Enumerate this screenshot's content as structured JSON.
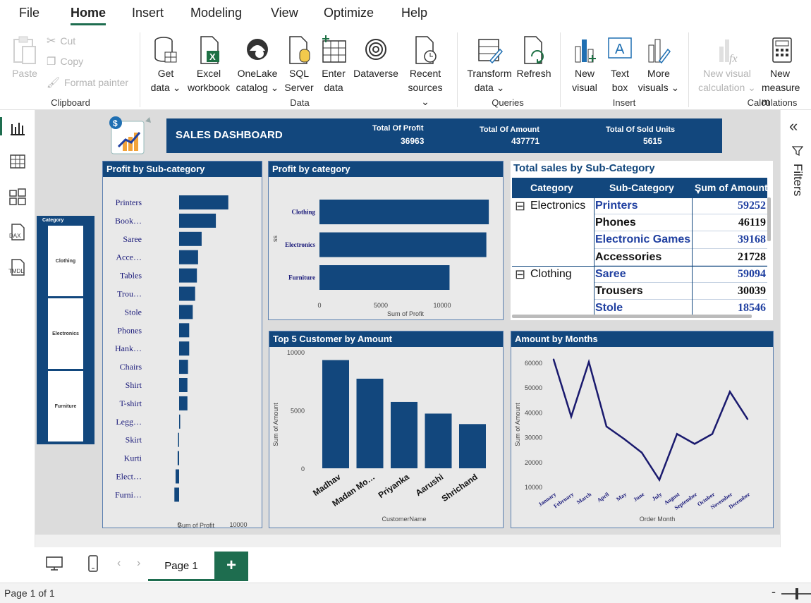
{
  "menu": [
    "File",
    "Home",
    "Insert",
    "Modeling",
    "View",
    "Optimize",
    "Help"
  ],
  "ribbon": {
    "clipboard": {
      "paste": "Paste",
      "cut": "Cut",
      "copy": "Copy",
      "format_painter": "Format painter",
      "group": "Clipboard"
    },
    "data": {
      "get_data": [
        "Get",
        "data ⌄"
      ],
      "excel": [
        "Excel",
        "workbook"
      ],
      "onelake": [
        "OneLake",
        "catalog ⌄"
      ],
      "sql": [
        "SQL",
        "Server"
      ],
      "enter": [
        "Enter",
        "data"
      ],
      "dataverse": [
        "Dataverse"
      ],
      "recent": [
        "Recent",
        "sources ⌄"
      ],
      "group": "Data"
    },
    "queries": {
      "transform": [
        "Transform",
        "data ⌄"
      ],
      "refresh": [
        "Refresh"
      ],
      "group": "Queries"
    },
    "insert": {
      "new_visual": [
        "New",
        "visual"
      ],
      "text_box": [
        "Text",
        "box"
      ],
      "more_visuals": [
        "More",
        "visuals ⌄"
      ],
      "group": "Insert"
    },
    "calculations": {
      "new_visual_calc": [
        "New visual",
        "calculation ⌄"
      ],
      "new_measure": [
        "New",
        "measure m"
      ],
      "group": "Calculations"
    }
  },
  "leftnav": [
    "report-view",
    "table-view",
    "model-view",
    "dax-view",
    "tmdl-view"
  ],
  "leftnav_labels": {
    "dax": "DAX",
    "tmdl": "TMDL"
  },
  "filters": {
    "label": "Filters",
    "collapse": "«"
  },
  "dashboard": {
    "title": "SALES DASHBOARD",
    "kpis": [
      {
        "label": "Total Of Profit",
        "value": "36963"
      },
      {
        "label": "Total Of Amount",
        "value": "437771"
      },
      {
        "label": "Total Of Sold Units",
        "value": "5615"
      }
    ],
    "slicer": {
      "title": "Category",
      "items": [
        "Clothing",
        "Electronics",
        "Furniture"
      ]
    },
    "matrix": {
      "title": "Total sales by Sub-Category",
      "headers": [
        "Category",
        "Sub-Category",
        "Sum of Amount"
      ],
      "rows": [
        {
          "category": "Electronics",
          "sub": "Printers",
          "amount": "59252",
          "link": true
        },
        {
          "category": "",
          "sub": "Phones",
          "amount": "46119",
          "link": false
        },
        {
          "category": "",
          "sub": "Electronic Games",
          "amount": "39168",
          "link": true
        },
        {
          "category": "",
          "sub": "Accessories",
          "amount": "21728",
          "link": false
        },
        {
          "category": "Clothing",
          "sub": "Saree",
          "amount": "59094",
          "link": true
        },
        {
          "category": "",
          "sub": "Trousers",
          "amount": "30039",
          "link": false
        },
        {
          "category": "",
          "sub": "Stole",
          "amount": "18546",
          "link": true
        }
      ],
      "expander": "⊟"
    }
  },
  "chart_data": [
    {
      "type": "bar",
      "orientation": "horizontal",
      "title": "Profit by Sub-category",
      "xlabel": "Sum of Profit",
      "ylabel": "",
      "categories": [
        "Printers",
        "Book…",
        "Saree",
        "Acce…",
        "Tables",
        "Trou…",
        "Stole",
        "Phones",
        "Hank…",
        "Chairs",
        "Shirt",
        "T-shirt",
        "Legg…",
        "Skirt",
        "Kurti",
        "Elect…",
        "Furni…"
      ],
      "values": [
        8300,
        6200,
        3800,
        3200,
        3000,
        2700,
        2300,
        1700,
        1700,
        1500,
        1400,
        1400,
        150,
        -180,
        -250,
        -600,
        -800
      ],
      "xlim": [
        -1000,
        10000
      ],
      "xticks": [
        "0",
        "10000"
      ],
      "grid": false
    },
    {
      "type": "bar",
      "orientation": "horizontal",
      "title": "Profit by category",
      "xlabel": "Sum of Profit",
      "ylabel": "ss",
      "categories": [
        "Clothing",
        "Electronics",
        "Furniture"
      ],
      "values": [
        13800,
        13600,
        10600
      ],
      "xlim": [
        0,
        14500
      ],
      "xticks": [
        "0",
        "5000",
        "10000"
      ],
      "grid": false
    },
    {
      "type": "bar",
      "title": "Top 5 Customer by Amount",
      "xlabel": "CustomerName",
      "ylabel": "Sum of Amount",
      "categories": [
        "Madhav",
        "Madan Mo…",
        "Priyanka",
        "Aarushi",
        "Shrichand"
      ],
      "values": [
        9300,
        7700,
        5700,
        4700,
        3800
      ],
      "ylim": [
        0,
        10000
      ],
      "yticks": [
        "0",
        "5000",
        "10000"
      ],
      "grid": false
    },
    {
      "type": "line",
      "title": "Amount by Months",
      "xlabel": "Order Month",
      "ylabel": "Sum of Amount",
      "categories": [
        "January",
        "February",
        "March",
        "April",
        "May",
        "June",
        "July",
        "August",
        "September",
        "October",
        "November",
        "December"
      ],
      "values": [
        61500,
        38500,
        60500,
        34500,
        29500,
        24000,
        13000,
        31500,
        27500,
        31500,
        48500,
        37500
      ],
      "ylim": [
        10000,
        63000
      ],
      "yticks": [
        "10000",
        "20000",
        "30000",
        "40000",
        "50000",
        "60000"
      ],
      "grid": false
    }
  ],
  "bottom": {
    "page_tab": "Page 1",
    "add_page": "+",
    "status": "Page 1 of 1",
    "zoom": "-",
    "nav_prev": "‹",
    "nav_next": "›"
  },
  "colors": {
    "accent": "#1e6d4f",
    "navy": "#12477d",
    "line": "#1a1a6e",
    "link": "#1f3fa0"
  }
}
